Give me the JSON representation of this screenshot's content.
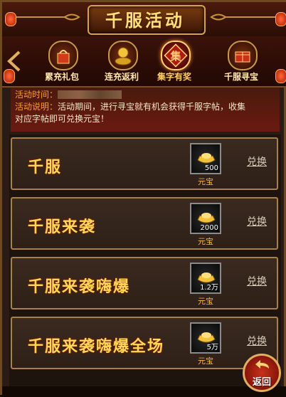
{
  "header": {
    "title": "千服活动"
  },
  "tabs": [
    {
      "label": "累充礼包",
      "icon": "gift-bag-icon"
    },
    {
      "label": "连充返利",
      "icon": "gold-coins-icon"
    },
    {
      "label": "集字有奖",
      "icon": "collect-character-icon",
      "active": true,
      "glyph": "集"
    },
    {
      "label": "千服寻宝",
      "icon": "treasure-chest-icon"
    }
  ],
  "info": {
    "time_label": "活动时间：",
    "desc_label": "活动说明：",
    "desc_text_1": "活动期间，进行寻宝就有机会获得千服字帖，收集",
    "desc_text_2": "对应字帖即可兑换元宝！"
  },
  "rewards": [
    {
      "name": "千服",
      "qty": "500",
      "unit": "元宝",
      "action": "兑换"
    },
    {
      "name": "千服来袭",
      "qty": "2000",
      "unit": "元宝",
      "action": "兑换"
    },
    {
      "name": "千服来袭嗨爆",
      "qty": "1.2万",
      "unit": "元宝",
      "action": "兑换"
    },
    {
      "name": "千服来袭嗨爆全场",
      "qty": "5万",
      "unit": "元宝",
      "action": "兑换"
    }
  ],
  "footer": {
    "return_label": "返回"
  },
  "colors": {
    "gold": "#ffd85a",
    "accent_orange": "#ff9a2e",
    "frame": "#a8804a"
  }
}
